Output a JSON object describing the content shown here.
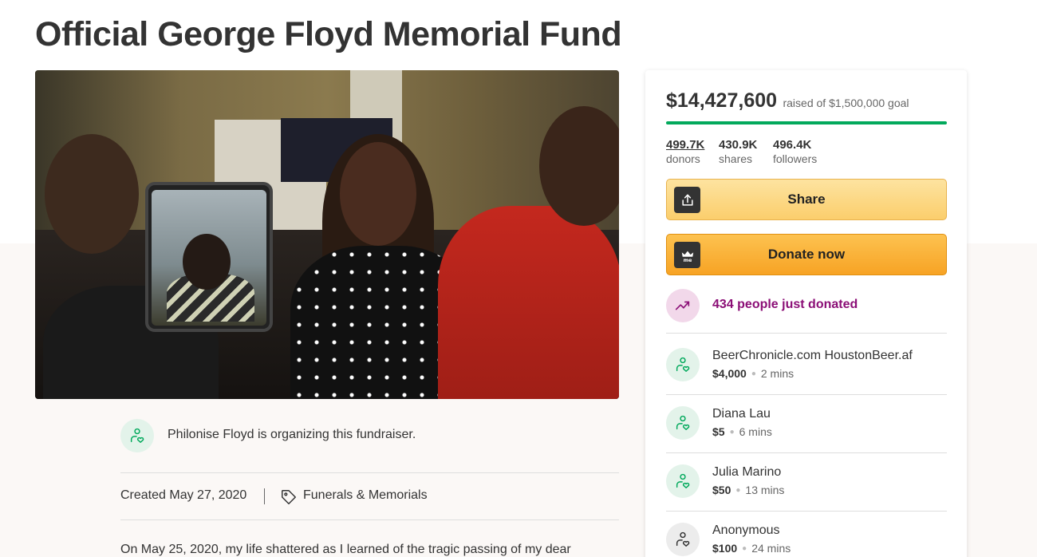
{
  "title": "Official George Floyd Memorial Fund",
  "organizer": {
    "text": "Philonise Floyd is organizing this fundraiser."
  },
  "meta": {
    "created": "Created May 27, 2020",
    "category": "Funerals & Memorials"
  },
  "story": {
    "first_line": "On May 25, 2020, my life shattered as I learned of the tragic passing of my dear"
  },
  "campaign": {
    "raised": "$14,427,600",
    "goal_text": "raised of $1,500,000 goal",
    "progress_fraction": 1.0,
    "stats": [
      {
        "value": "499.7K",
        "label": "donors"
      },
      {
        "value": "430.9K",
        "label": "shares"
      },
      {
        "value": "496.4K",
        "label": "followers"
      }
    ],
    "share_label": "Share",
    "donate_label": "Donate now",
    "recent_text": "434 people just donated",
    "accent_green": "#02a95c",
    "accent_purple": "#8b0e76"
  },
  "donations": [
    {
      "name": "BeerChronicle.com HoustonBeer.af",
      "amount": "$4,000",
      "time": "2 mins",
      "avatar": "heart-hand-icon"
    },
    {
      "name": "Diana Lau",
      "amount": "$5",
      "time": "6 mins",
      "avatar": "heart-hand-icon"
    },
    {
      "name": "Julia Marino",
      "amount": "$50",
      "time": "13 mins",
      "avatar": "heart-hand-icon"
    },
    {
      "name": "Anonymous",
      "amount": "$100",
      "time": "24 mins",
      "avatar": "heart-hand-icon"
    }
  ]
}
